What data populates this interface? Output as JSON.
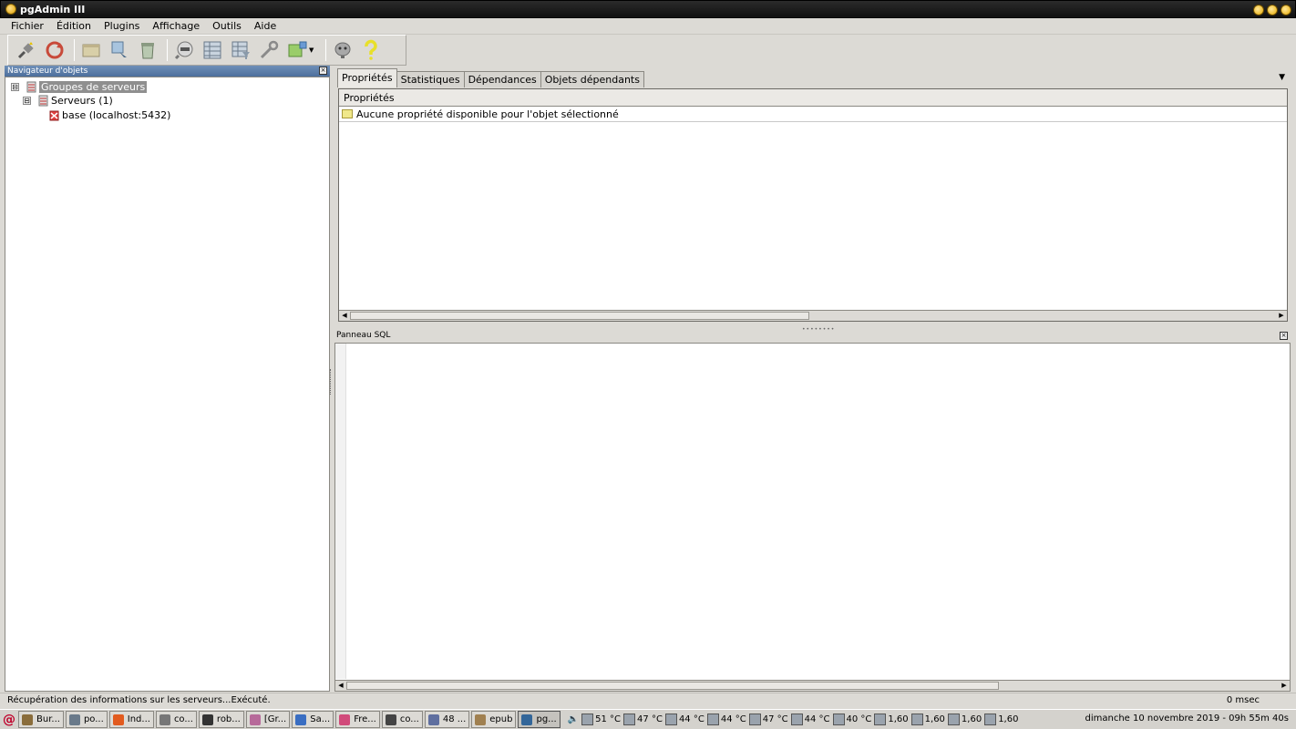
{
  "window": {
    "title": "pgAdmin III"
  },
  "menu": [
    "Fichier",
    "Édition",
    "Plugins",
    "Affichage",
    "Outils",
    "Aide"
  ],
  "toolbar": {
    "icons": [
      "connect-icon",
      "refresh-icon",
      "properties-icon",
      "create-object-icon",
      "drop-object-icon",
      "sql-query-icon",
      "view-data-icon",
      "filtered-data-icon",
      "maintenance-icon",
      "plugins-icon",
      "hint-icon",
      "help-icon"
    ]
  },
  "browser": {
    "title": "Navigateur d'objets",
    "tree": [
      {
        "label": "Groupes de serveurs",
        "toggle": "⊟",
        "level": 0,
        "selected": true
      },
      {
        "label": "Serveurs (1)",
        "toggle": "⊟",
        "level": 1
      },
      {
        "label": "base (localhost:5432)",
        "toggle": "",
        "level": 2
      }
    ]
  },
  "tabs": [
    "Propriétés",
    "Statistiques",
    "Dépendances",
    "Objets dépendants"
  ],
  "active_tab": "Propriétés",
  "properties": {
    "column_header": "Propriétés",
    "empty_message": "Aucune propriété disponible pour l'objet sélectionné"
  },
  "sql_panel": {
    "title": "Panneau SQL"
  },
  "status": {
    "message": "Récupération des informations sur les serveurs...Exécuté.",
    "time": "0 msec"
  },
  "taskbar": {
    "tasks": [
      {
        "label": "Bur...",
        "color": "#8a6d3b"
      },
      {
        "label": "po...",
        "color": "#6a7a8a"
      },
      {
        "label": "Ind...",
        "color": "#e25b1f"
      },
      {
        "label": "co...",
        "color": "#777777"
      },
      {
        "label": "rob...",
        "color": "#333333"
      },
      {
        "label": "[Gr...",
        "color": "#b76a9a"
      },
      {
        "label": "Sa...",
        "color": "#3a6ec2"
      },
      {
        "label": "Fre...",
        "color": "#d14a7a"
      },
      {
        "label": "co...",
        "color": "#444444"
      },
      {
        "label": "48 ...",
        "color": "#5f6f9f"
      },
      {
        "label": "epub",
        "color": "#a08050"
      },
      {
        "label": "pg...",
        "color": "#336699",
        "active": true
      }
    ],
    "tray": [
      "51 °C",
      "47 °C",
      "44 °C",
      "44 °C",
      "47 °C",
      "44 °C",
      "40 °C",
      "1,60",
      "1,60",
      "1,60",
      "1,60"
    ],
    "clock": "dimanche 10 novembre 2019 - 09h 55m 40s"
  }
}
